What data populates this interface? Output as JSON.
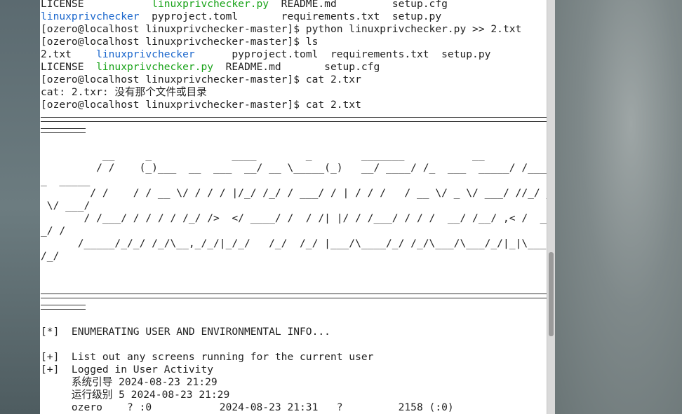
{
  "terminal": {
    "lines": [
      {
        "parts": [
          {
            "t": "LICENSE           "
          },
          {
            "t": "linuxprivchecker.py",
            "c": "g"
          },
          {
            "t": "  README.md         setup.cfg"
          }
        ]
      },
      {
        "parts": [
          {
            "t": "linuxprivchecker",
            "c": "b"
          },
          {
            "t": "  pyproject.toml       requirements.txt  setup.py"
          }
        ]
      },
      {
        "parts": [
          {
            "t": "[ozero@localhost linuxprivchecker-master]$ python linuxprivchecker.py >> 2.txt"
          }
        ]
      },
      {
        "parts": [
          {
            "t": "[ozero@localhost linuxprivchecker-master]$ ls"
          }
        ]
      },
      {
        "parts": [
          {
            "t": "2.txt    "
          },
          {
            "t": "linuxprivchecker",
            "c": "b"
          },
          {
            "t": "      pyproject.toml  requirements.txt  setup.py"
          }
        ]
      },
      {
        "parts": [
          {
            "t": "LICENSE  "
          },
          {
            "t": "linuxprivchecker.py",
            "c": "g"
          },
          {
            "t": "  README.md       setup.cfg"
          }
        ]
      },
      {
        "parts": [
          {
            "t": "[ozero@localhost linuxprivchecker-master]$ cat 2.txr"
          }
        ]
      },
      {
        "parts": [
          {
            "t": "cat: 2.txr: 没有那个文件或目录"
          }
        ]
      },
      {
        "parts": [
          {
            "t": "[ozero@localhost linuxprivchecker-master]$ cat 2.txt"
          }
        ]
      },
      {
        "parts": [
          {
            "t": ""
          }
        ]
      },
      {
        "parts": [
          {
            "t": ""
          }
        ]
      },
      {
        "parts": [
          {
            "t": ""
          }
        ]
      },
      {
        "parts": [
          {
            "t": "          __     _             ____        _        _______           __"
          }
        ]
      },
      {
        "parts": [
          {
            "t": "         / /    (_)___  __  ___  __/ __ \\_____(_)   __/ ____/ /_  ___  _____/ /____"
          }
        ]
      },
      {
        "parts": [
          {
            "t": "_  _____"
          }
        ]
      },
      {
        "parts": [
          {
            "t": "        / /    / / __ \\/ / / / |/_/ /_/ / ___/ / | / / /   / __ \\/ _ \\/ ___/ //_/ _"
          }
        ]
      },
      {
        "parts": [
          {
            "t": " \\/ ___/"
          }
        ]
      },
      {
        "parts": [
          {
            "t": "       / /___/ / / / / /_/ />  </ ____/ /  / /| |/ / /___/ / / /  __/ /__/ ,< /  __"
          }
        ]
      },
      {
        "parts": [
          {
            "t": "_/ /"
          }
        ]
      },
      {
        "parts": [
          {
            "t": "      /_____/_/_/ /_/\\__,_/_/|_/_/   /_/  /_/ |___/\\____/_/ /_/\\___/\\___/_/|_|\\___"
          }
        ]
      },
      {
        "parts": [
          {
            "t": "/_/"
          }
        ]
      },
      {
        "parts": [
          {
            "t": ""
          }
        ]
      },
      {
        "parts": [
          {
            "t": ""
          }
        ]
      },
      {
        "parts": [
          {
            "t": ""
          }
        ]
      },
      {
        "parts": [
          {
            "t": ""
          }
        ]
      },
      {
        "parts": [
          {
            "t": "[*]  ENUMERATING USER AND ENVIRONMENTAL INFO..."
          }
        ]
      },
      {
        "parts": [
          {
            "t": ""
          }
        ]
      },
      {
        "parts": [
          {
            "t": "[+]  List out any screens running for the current user"
          }
        ]
      },
      {
        "parts": [
          {
            "t": "[+]  Logged in User Activity"
          }
        ]
      },
      {
        "parts": [
          {
            "t": "     系统引导 2024-08-23 21:29"
          }
        ]
      },
      {
        "parts": [
          {
            "t": "     运行级别 5 2024-08-23 21:29"
          }
        ]
      },
      {
        "parts": [
          {
            "t": "     ozero    ? :0           2024-08-23 21:31   ?         2158 (:0)"
          }
        ]
      }
    ]
  }
}
